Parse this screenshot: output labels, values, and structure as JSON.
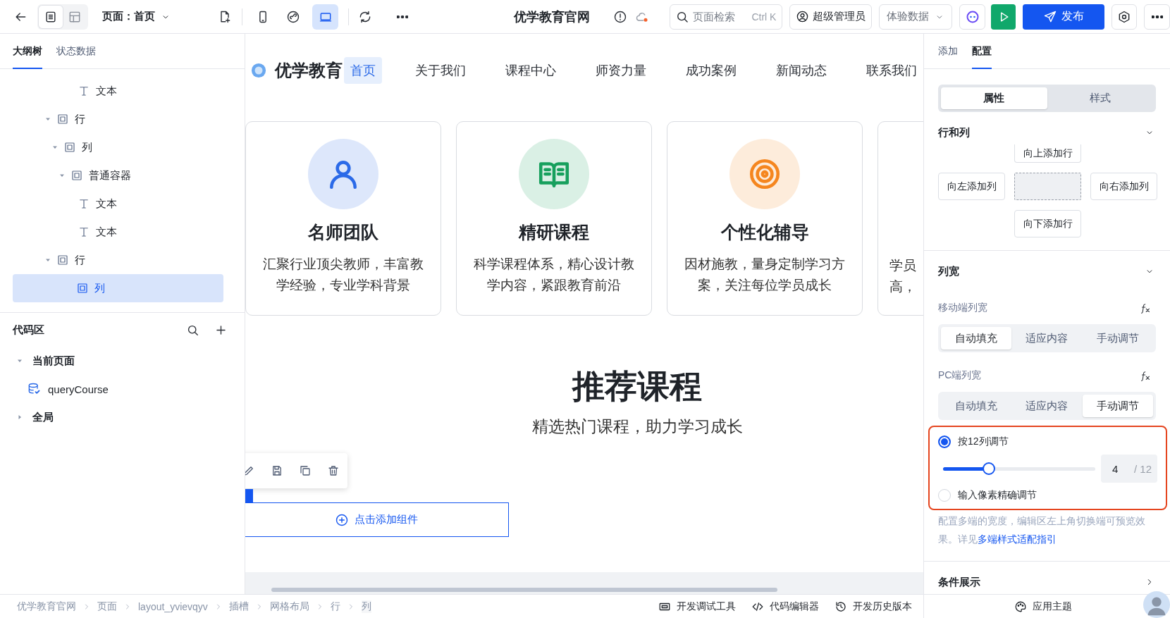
{
  "top_bar": {
    "view_toggle": [
      {
        "selected": true
      },
      {
        "selected": false
      }
    ],
    "page_selector": "页面：首页",
    "devices": [
      {
        "selected": false
      },
      {
        "selected": false
      },
      {
        "selected": true
      }
    ],
    "title": "优学教育官网",
    "search": {
      "placeholder": "页面检索",
      "shortcut": "Ctrl K"
    },
    "user": "超级管理员",
    "data_mode": "体验数据",
    "publish": "发布"
  },
  "left_panel": {
    "tabs": [
      {
        "label": "大纲树",
        "selected": true
      },
      {
        "label": "状态数据",
        "selected": false
      }
    ],
    "outline": [
      {
        "children": [
          {
            "children": [
              {
                "children": [
                  {
                    "label": "文本",
                    "kind": "text",
                    "selected": false
                  }
                ]
              }
            ]
          }
        ]
      },
      {
        "label": "行",
        "kind": "container",
        "expanded": true,
        "selected": false,
        "children": [
          {
            "label": "列",
            "kind": "container",
            "expanded": true,
            "selected": false,
            "children": [
              {
                "label": "普通容器",
                "kind": "container",
                "expanded": true,
                "selected": false,
                "children": [
                  {
                    "label": "文本",
                    "kind": "text",
                    "selected": false
                  },
                  {
                    "label": "文本",
                    "kind": "text",
                    "selected": false
                  }
                ]
              }
            ]
          }
        ]
      },
      {
        "label": "行",
        "kind": "container",
        "expanded": true,
        "selected": false,
        "children": [
          {
            "label": "列",
            "kind": "container",
            "selected": true
          }
        ]
      }
    ],
    "code_area": {
      "title": "代码区",
      "groups": [
        {
          "label": "当前页面",
          "expanded": true,
          "children": [
            {
              "label": "queryCourse"
            }
          ]
        },
        {
          "label": "全局",
          "expanded": false
        }
      ]
    }
  },
  "canvas": {
    "site_header": {
      "logo": "优学教育",
      "nav": [
        {
          "label": "首页",
          "selected": true
        },
        {
          "label": "关于我们",
          "selected": false
        },
        {
          "label": "课程中心",
          "selected": false
        },
        {
          "label": "师资力量",
          "selected": false
        },
        {
          "label": "成功案例",
          "selected": false
        },
        {
          "label": "新闻动态",
          "selected": false
        },
        {
          "label": "联系我们",
          "selected": false
        }
      ]
    },
    "features": [
      {
        "title": "名师团队",
        "color": "#2b6ae8",
        "lines": [
          "汇聚行业顶尖教师，丰富教",
          "学经验，专业学科背景"
        ]
      },
      {
        "title": "精研课程",
        "color": "#17a05d",
        "lines": [
          "科学课程体系，精心设计教",
          "学内容，紧跟教育前沿"
        ]
      },
      {
        "title": "个性化辅导",
        "color": "#f5861f",
        "lines": [
          "因材施教，量身定制学习方",
          "案，关注每位学员成长"
        ]
      },
      {
        "lines": [
          "学员",
          "高，"
        ]
      }
    ],
    "section": {
      "title": "推荐课程",
      "subtitle": "精选热门课程，助力学习成长"
    },
    "add_component": "点击添加组件"
  },
  "right_panel": {
    "tabs": [
      {
        "label": "添加",
        "selected": false
      },
      {
        "label": "配置",
        "selected": true
      }
    ],
    "mode_tabs": [
      {
        "label": "属性",
        "selected": true
      },
      {
        "label": "样式",
        "selected": false
      }
    ],
    "rows_and_columns": {
      "title": "行和列",
      "expanded": true,
      "add_row_above": "向上添加行",
      "add_column_left": "向左添加列",
      "add_column_right": "向右添加列",
      "add_row_below": "向下添加行"
    },
    "column_width": {
      "title": "列宽",
      "expanded": true,
      "mobile": {
        "label": "移动端列宽",
        "options": [
          {
            "label": "自动填充",
            "selected": true
          },
          {
            "label": "适应内容",
            "selected": false
          },
          {
            "label": "手动调节",
            "selected": false
          }
        ]
      },
      "pc": {
        "label": "PC端列宽",
        "options": [
          {
            "label": "自动填充",
            "selected": false
          },
          {
            "label": "适应内容",
            "selected": false
          },
          {
            "label": "手动调节",
            "selected": true
          }
        ]
      },
      "modes": [
        {
          "label": "按12列调节",
          "selected": true
        },
        {
          "label": "输入像素精确调节",
          "selected": false
        }
      ],
      "slider": {
        "level": 0.3
      },
      "value": "4",
      "total": "/ 12",
      "help": "配置多端的宽度，编辑区左上角切换端可预览效果。详见",
      "help_link": "多端样式适配指引"
    },
    "condition": {
      "title": "条件展示",
      "expanded": false
    },
    "theme_button": "应用主题"
  },
  "status_bar": {
    "breadcrumbs": [
      "优学教育官网",
      "页面",
      "layout_yvievqyv",
      "插槽",
      "网格布局",
      "行",
      "列"
    ],
    "tools": [
      "开发调试工具",
      "代码编辑器",
      "开发历史版本"
    ]
  }
}
